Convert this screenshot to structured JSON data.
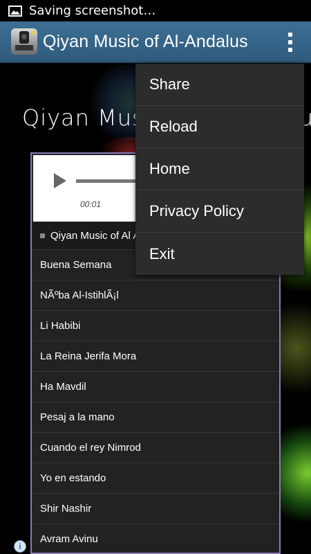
{
  "status_bar": {
    "notification_text": "Saving screenshot…",
    "icon": "image-icon"
  },
  "action_bar": {
    "app_icon": "app-logo-icon",
    "title": "Qiyan Music of Al-Andalus",
    "overflow_icon": "overflow-menu-icon"
  },
  "page": {
    "heading": "Qiyan Music of Al-Andalus"
  },
  "player": {
    "play_icon": "play-icon",
    "time": "00:01",
    "now_playing": "Qiyan Music of Al Andalus"
  },
  "tracks": [
    "Buena Semana",
    "NÃºba Al-IstihlÃ¡l",
    "Li Habibi",
    "La Reina Jerifa Mora",
    "Ha Mavdil",
    "Pesaj a la mano",
    "Cuando el rey Nimrod",
    "Yo en estando",
    "Shir Nashir",
    "Avram Avinu"
  ],
  "menu": {
    "items": [
      "Share",
      "Reload",
      "Home",
      "Privacy Policy",
      "Exit"
    ]
  },
  "ad_badge": {
    "icon": "info-icon",
    "label": "i"
  },
  "colors": {
    "action_bar": "#2f5b7d",
    "menu_bg": "#2c2c2c",
    "list_bg": "#222222",
    "player_border": "#8a7ab6"
  }
}
